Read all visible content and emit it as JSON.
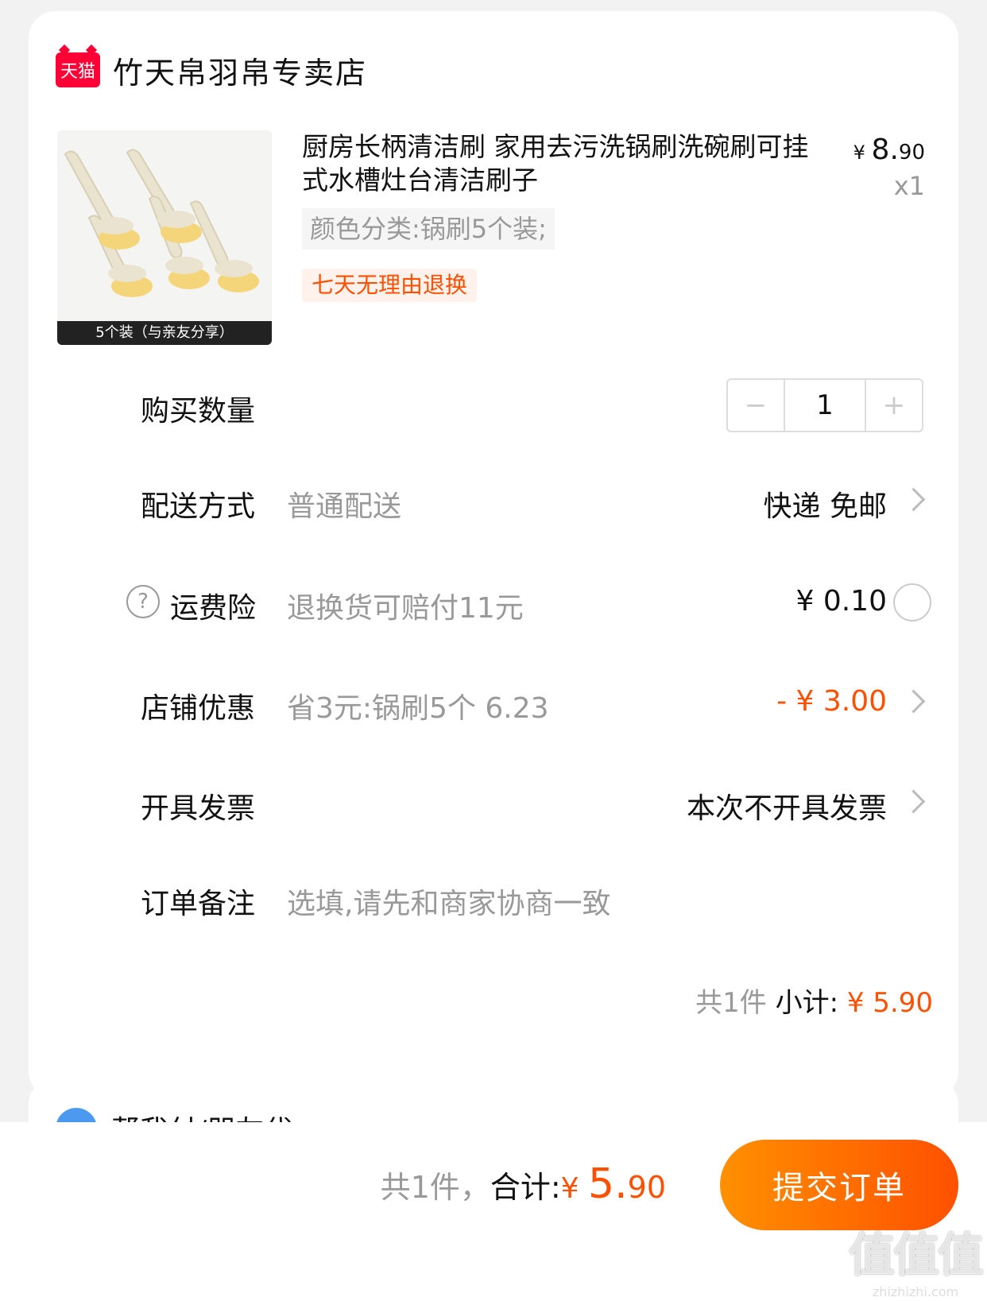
{
  "store": {
    "logo_text": "天猫",
    "name": "竹天帛羽帛专卖店"
  },
  "product": {
    "image_caption": "5个装（与亲友分享）",
    "title": "厨房长柄清洁刷 家用去污洗锅刷洗碗刷可挂式水槽灶台清洁刷子",
    "price_yen": "¥ ",
    "price_int": "8.",
    "price_dec": "90",
    "qty": "x1",
    "sku": "颜色分类:锅刷5个装;",
    "refund_tag": "七天无理由退换"
  },
  "quantity": {
    "label": "购买数量",
    "value": "1",
    "minus": "−",
    "plus": "+"
  },
  "delivery": {
    "label": "配送方式",
    "value": "普通配送",
    "right": "快递 免邮"
  },
  "insurance": {
    "icon": "?",
    "label": "运费险",
    "value": "退换货可赔付11元",
    "right": "¥ 0.10"
  },
  "discount": {
    "label": "店铺优惠",
    "value": "省3元:锅刷5个 6.23",
    "right": "- ¥ 3.00"
  },
  "invoice": {
    "label": "开具发票",
    "right": "本次不开具发票"
  },
  "note": {
    "label": "订单备注",
    "placeholder": "选填,请先和商家协商一致"
  },
  "subtotal": {
    "count": "共1件 ",
    "label": "小计: ",
    "amount": "¥ 5.90"
  },
  "pay_for_me": {
    "label": "帮我付/朋友代"
  },
  "footer": {
    "count": "共1件，",
    "label": "合计:",
    "yen": "¥ ",
    "int": "5.",
    "dec": "90",
    "submit": "提交订单"
  },
  "watermark": {
    "big": "值值值",
    "small": "zhizhizhi.com"
  },
  "colors": {
    "accent": "#ff5000",
    "tmall_red": "#ff0036",
    "background": "#f2f2f2"
  }
}
